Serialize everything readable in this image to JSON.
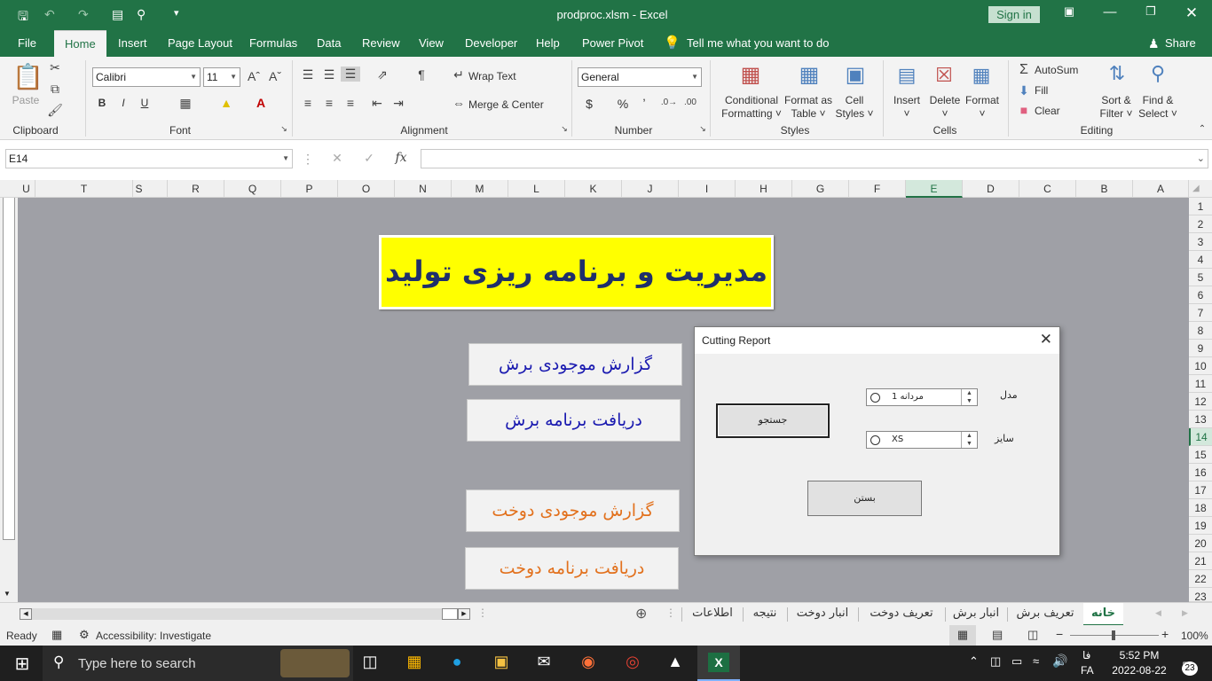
{
  "window": {
    "title": "prodproc.xlsm  -  Excel",
    "signin": "Sign in"
  },
  "menu_tabs": [
    "File",
    "Home",
    "Insert",
    "Page Layout",
    "Formulas",
    "Data",
    "Review",
    "View",
    "Developer",
    "Help",
    "Power Pivot"
  ],
  "tell_me": "Tell me what you want to do",
  "share": "Share",
  "ribbon": {
    "clipboard": {
      "paste": "Paste",
      "label": "Clipboard"
    },
    "font": {
      "name": "Calibri",
      "size": "11",
      "label": "Font",
      "bold": "B",
      "italic": "I",
      "underline": "U"
    },
    "alignment": {
      "wrap": "Wrap Text",
      "merge": "Merge & Center",
      "label": "Alignment"
    },
    "number": {
      "format": "General",
      "currency": "$",
      "percent": "%",
      "comma": "ʼ",
      "label": "Number"
    },
    "styles": {
      "cond1": "Conditional",
      "cond2": "Formatting",
      "table1": "Format as",
      "table2": "Table",
      "cell1": "Cell",
      "cell2": "Styles",
      "label": "Styles"
    },
    "cells": {
      "insert": "Insert",
      "delete": "Delete",
      "format": "Format",
      "label": "Cells"
    },
    "editing": {
      "autosum": "AutoSum",
      "fill": "Fill",
      "clear": "Clear",
      "sort1": "Sort &",
      "sort2": "Filter",
      "find1": "Find &",
      "find2": "Select",
      "label": "Editing"
    }
  },
  "formula_bar": {
    "name_box": "E14",
    "fx": "fx",
    "value": ""
  },
  "columns": [
    "U",
    "T",
    "S",
    "R",
    "Q",
    "P",
    "O",
    "N",
    "M",
    "L",
    "K",
    "J",
    "I",
    "H",
    "G",
    "F",
    "E",
    "D",
    "C",
    "B",
    "A"
  ],
  "selected_column": "E",
  "rows": [
    "1",
    "2",
    "3",
    "4",
    "5",
    "6",
    "7",
    "8",
    "9",
    "10",
    "11",
    "12",
    "13",
    "14",
    "15",
    "16",
    "17",
    "18",
    "19",
    "20",
    "21",
    "22",
    "23"
  ],
  "selected_row": "14",
  "sheet": {
    "title": "مدیریت و برنامه ریزی تولید",
    "buttons": [
      "گزارش موجودی برش",
      "دریافت برنامه برش",
      "گزارش موجودی دوخت",
      "دریافت برنامه دوخت"
    ]
  },
  "dialog": {
    "title": "Cutting Report",
    "model_label": "مدل",
    "model_value": "مردانه 1",
    "size_label": "سایز",
    "size_value": "XS",
    "search_button": "جستجو",
    "close_button": "بستن"
  },
  "sheet_tabs": [
    "خانه",
    "تعریف برش",
    "انبار برش",
    "تعریف دوخت",
    "انبار دوخت",
    "نتیجه",
    "اطلاعات"
  ],
  "active_sheet_tab": "خانه",
  "status": {
    "ready": "Ready",
    "accessibility": "Accessibility: Investigate",
    "zoom": "100%"
  },
  "taskbar": {
    "search": "Type here to search",
    "time": "5:52 PM",
    "date": "2022-08-22",
    "lang1": "فا",
    "lang2": "FA",
    "notif": "23"
  },
  "colors": {
    "excel_green": "#217346",
    "sheet_bg": "#9fa0a6",
    "title_yellow": "#ffff00",
    "blue_text": "#1a1ab0",
    "orange_text": "#e2711d"
  }
}
